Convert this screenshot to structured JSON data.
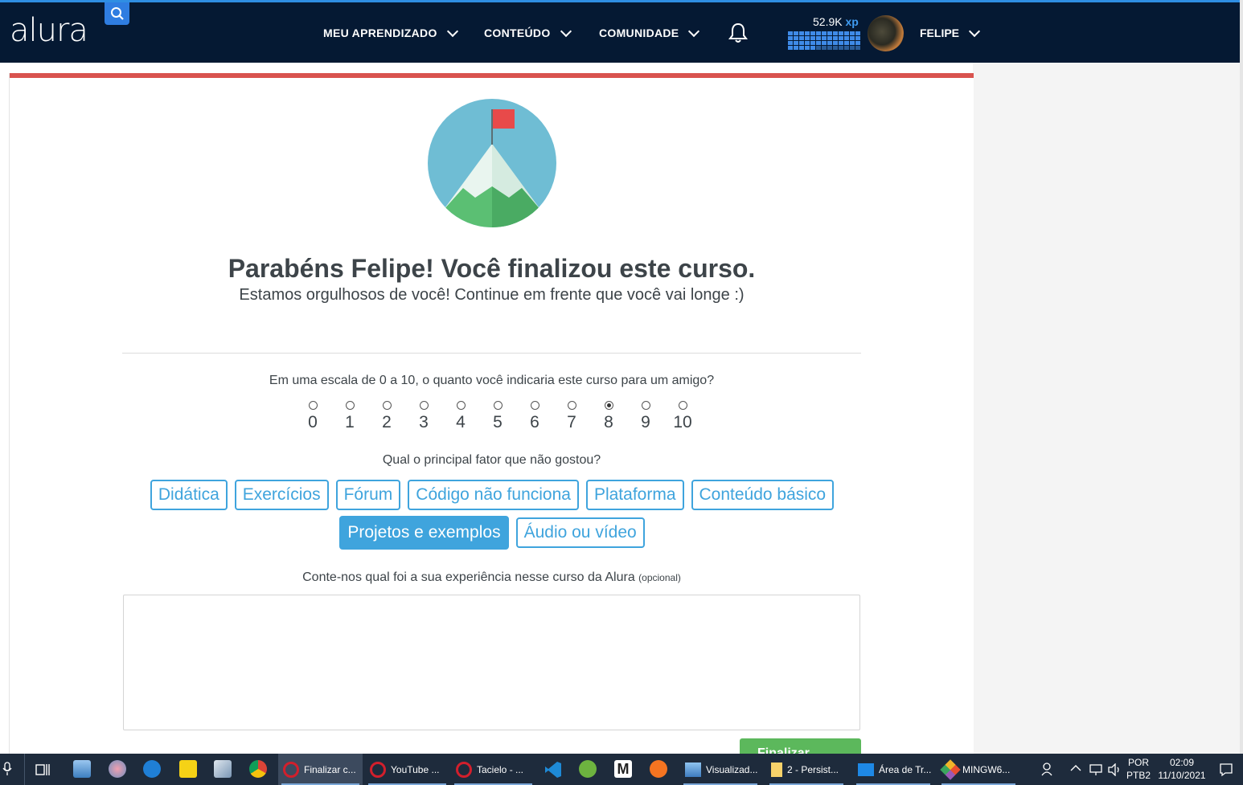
{
  "header": {
    "logo": "alura",
    "nav": [
      {
        "label": "MEU APRENDIZADO"
      },
      {
        "label": "CONTEÚDO"
      },
      {
        "label": "COMUNIDADE"
      }
    ],
    "xp_value": "52.9K",
    "xp_unit": "xp",
    "user_name": "FELIPE"
  },
  "completion": {
    "title": "Parabéns Felipe! Você finalizou este curso.",
    "subtitle": "Estamos orgulhosos de você! Continue em frente que você vai longe :)"
  },
  "survey": {
    "question": "Em uma escala de 0 a 10, o quanto você indicaria este curso para um amigo?",
    "scale": [
      "0",
      "1",
      "2",
      "3",
      "4",
      "5",
      "6",
      "7",
      "8",
      "9",
      "10"
    ],
    "selected_score": "8",
    "factor_question": "Qual o principal fator que não gostou?",
    "factors": [
      "Didática",
      "Exercícios",
      "Fórum",
      "Código não funciona",
      "Plataforma",
      "Conteúdo básico",
      "Projetos e exemplos",
      "Áudio ou vídeo"
    ],
    "selected_factor": "Projetos e exemplos",
    "experience_label": "Conte-nos qual foi a sua experiência nesse curso da Alura",
    "experience_optional": "(opcional)",
    "experience_value": "",
    "submit_label": "Finalizar"
  },
  "taskbar": {
    "apps": [
      {
        "label": "Finalizar c..."
      },
      {
        "label": "YouTube ..."
      },
      {
        "label": "Tacielo - ..."
      },
      {
        "label": "Visualizad..."
      },
      {
        "label": "2 - Persist..."
      },
      {
        "label": "Área de Tr..."
      },
      {
        "label": "MINGW6..."
      }
    ],
    "language": "POR",
    "layout": "PTB2",
    "time": "02:09",
    "date": "11/10/2021"
  },
  "colors": {
    "navbar": "#051933",
    "accent": "#3fa4dd",
    "card_top": "#d9534f",
    "finish": "#5cb85c"
  }
}
